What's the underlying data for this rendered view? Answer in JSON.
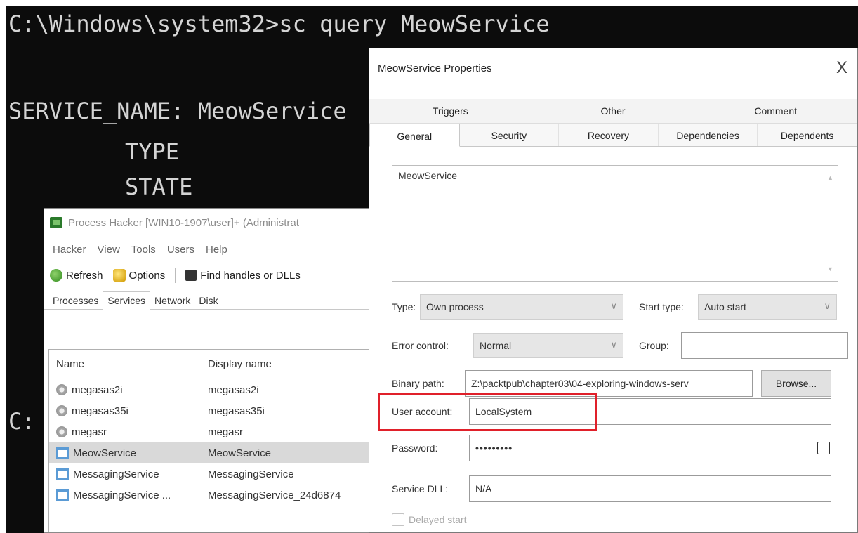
{
  "console": {
    "command": "C:\\Windows\\system32>sc query MeowService",
    "service_line": "SERVICE_NAME: MeowService",
    "type_label": "TYPE",
    "state_label": "STATE",
    "prompt_fragment": "C:"
  },
  "process_hacker": {
    "title": "Process Hacker [WIN10-1907\\user]+ (Administrat",
    "menu": [
      "Hacker",
      "View",
      "Tools",
      "Users",
      "Help"
    ],
    "toolbar": {
      "refresh": "Refresh",
      "options": "Options",
      "find": "Find handles or DLLs"
    },
    "tabs": [
      "Processes",
      "Services",
      "Network",
      "Disk"
    ],
    "active_tab": "Services",
    "columns": {
      "name": "Name",
      "display": "Display name"
    },
    "rows": [
      {
        "name": "megasas2i",
        "display": "megasas2i",
        "icon": "gear-icon"
      },
      {
        "name": "megasas35i",
        "display": "megasas35i",
        "icon": "gear-icon"
      },
      {
        "name": "megasr",
        "display": "megasr",
        "icon": "gear-icon"
      },
      {
        "name": "MeowService",
        "display": "MeowService",
        "icon": "window-icon",
        "selected": true
      },
      {
        "name": "MessagingService",
        "display": "MessagingService",
        "icon": "window-icon"
      },
      {
        "name": "MessagingService ...",
        "display": "MessagingService_24d6874",
        "icon": "window-icon"
      }
    ]
  },
  "dialog": {
    "title": "MeowService Properties",
    "close": "X",
    "tabs_back": [
      "Triggers",
      "Other",
      "Comment"
    ],
    "tabs_front": [
      "General",
      "Security",
      "Recovery",
      "Dependencies",
      "Dependents"
    ],
    "active_tab": "General",
    "description": "MeowService",
    "type_label": "Type:",
    "type_value": "Own process",
    "start_type_label": "Start type:",
    "start_type_value": "Auto start",
    "error_control_label": "Error control:",
    "error_control_value": "Normal",
    "group_label": "Group:",
    "group_value": "",
    "binary_path_label": "Binary path:",
    "binary_path_value": "Z:\\packtpub\\chapter03\\04-exploring-windows-serv",
    "browse": "Browse...",
    "user_account_label": "User account:",
    "user_account_value": "LocalSystem",
    "password_label": "Password:",
    "password_value": "•••••••••",
    "service_dll_label": "Service DLL:",
    "service_dll_value": "N/A",
    "delayed_start_label": "Delayed start",
    "highlight_color": "#e0202a"
  }
}
